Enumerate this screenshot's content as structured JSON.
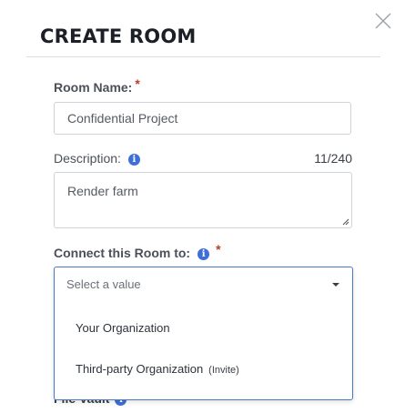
{
  "dialog": {
    "title": "CREATE ROOM"
  },
  "room_name": {
    "label": "Room Name:",
    "required_mark": "*",
    "value": "Confidential Project"
  },
  "description": {
    "label": "Description:",
    "value": "Render farm",
    "counter": "11/240"
  },
  "connect": {
    "label": "Connect this Room to:",
    "required_mark": "*",
    "placeholder": "Select a value",
    "options": [
      {
        "label": "Your Organization",
        "note": ""
      },
      {
        "label": "Third-party Organization",
        "note": "(Invite)"
      }
    ]
  },
  "file_vault": {
    "label": "File Vault"
  },
  "icons": {
    "close": "close-icon",
    "info": "info-icon",
    "caret": "caret-down-icon"
  },
  "colors": {
    "required": "#c0392b",
    "info": "#3e6fd8",
    "focus_border": "#4a78c8"
  }
}
